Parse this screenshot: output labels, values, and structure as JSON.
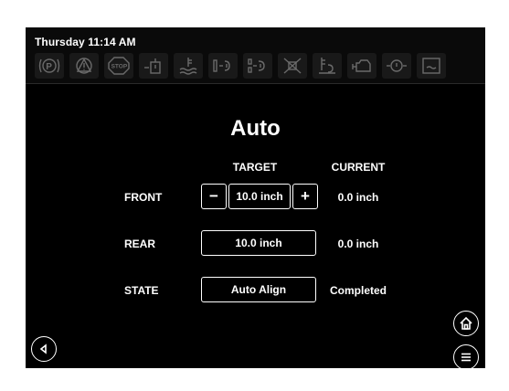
{
  "header": {
    "clock": "Thursday 11:14 AM",
    "warning_icons": [
      "parking-brake-icon",
      "warning-triangle-icon",
      "stop-icon",
      "level-warning-icon",
      "coolant-icon",
      "front-axle-icon",
      "rear-axle-icon",
      "traction-icon",
      "oil-level-icon",
      "engine-icon",
      "tpms-icon",
      "battery-icon"
    ],
    "stop_text": "STOP",
    "parking_text": "P"
  },
  "main": {
    "title": "Auto",
    "col_target": "TARGET",
    "col_current": "CURRENT",
    "rows": [
      {
        "label": "FRONT",
        "target": "10.0 inch",
        "current": "0.0 inch",
        "minus": "−",
        "plus": "+"
      },
      {
        "label": "REAR",
        "target": "10.0 inch",
        "current": "0.0 inch"
      },
      {
        "label": "STATE",
        "target": "Auto Align",
        "current": "Completed"
      }
    ]
  },
  "nav": {
    "back": "back-icon",
    "home": "home-icon",
    "menu": "menu-icon"
  },
  "colors": {
    "background": "#000000",
    "foreground": "#ffffff",
    "inactive_icon": "#6a6a6a"
  }
}
